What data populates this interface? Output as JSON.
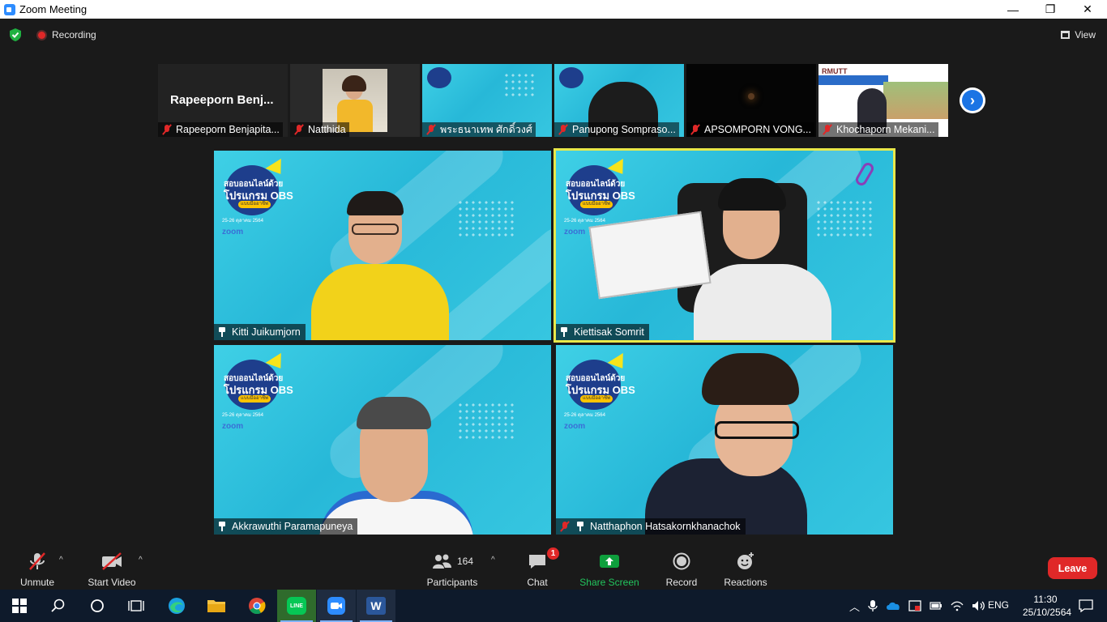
{
  "window": {
    "title": "Zoom Meeting",
    "minimize_glyph": "—",
    "restore_glyph": "❐",
    "close_glyph": "✕"
  },
  "meeting_bar": {
    "recording_label": "Recording",
    "view_label": "View"
  },
  "thumbnails": [
    {
      "label": "Rapeeporn Benjapita...",
      "display": "Rapeeporn Benj...",
      "muted": true,
      "video": false
    },
    {
      "label": "Natthida",
      "muted": true,
      "video": true
    },
    {
      "label": "พระธนาเทพ ศักดิ์วงศ์",
      "muted": true,
      "video": true
    },
    {
      "label": "Panupong Somprasо...",
      "muted": true,
      "video": true
    },
    {
      "label": "APSOMPORN VONG...",
      "muted": true,
      "video": true
    },
    {
      "label": "Khochaporn Mekani...",
      "muted": true,
      "video": true
    }
  ],
  "next_page_glyph": "›",
  "tiles": [
    {
      "name": "Kitti Juikumjorn",
      "pinned": true,
      "muted": false
    },
    {
      "name": "Kiettisak Somrit",
      "pinned": true,
      "muted": false,
      "active": true
    },
    {
      "name": "Akkrawuthi Paramapuneya",
      "pinned": true,
      "muted": false
    },
    {
      "name": "Natthaphon Hatsakornkhanachok",
      "pinned": true,
      "muted": true
    }
  ],
  "background": {
    "logo_line1": "สอบออนไลน์ด้วย",
    "logo_line2": "โปรแกรม OBS",
    "logo_pill": "แบบมืออาชีพ",
    "date_line": "25-26 ตุลาคม 2564",
    "platform": "zoom"
  },
  "controls": {
    "unmute_label": "Unmute",
    "start_video_label": "Start Video",
    "participants_label": "Participants",
    "participants_count": "164",
    "chat_label": "Chat",
    "chat_badge": "1",
    "share_label": "Share Screen",
    "record_label": "Record",
    "reactions_label": "Reactions",
    "leave_label": "Leave",
    "caret_glyph": "^"
  },
  "taskbar": {
    "language": "ENG",
    "time": "11:30",
    "date": "25/10/2564",
    "line_app_label": "LINE",
    "word_app_label": "W"
  },
  "colors": {
    "accent_blue": "#2d8cff",
    "leave_red": "#e02828",
    "share_green": "#0e9f3d",
    "active_border": "#e8e84a"
  }
}
